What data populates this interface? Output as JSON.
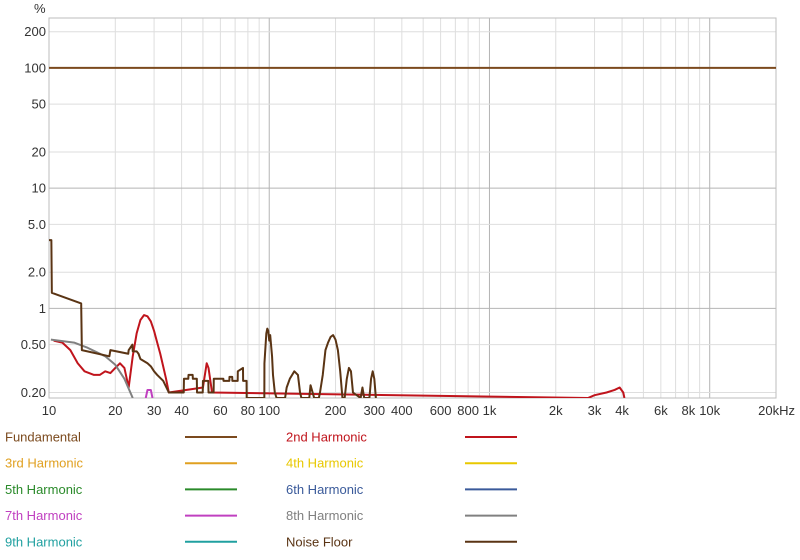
{
  "chart_data": {
    "type": "line",
    "x_scale": "log",
    "y_scale": "log",
    "xlim": [
      10,
      20000
    ],
    "ylim": [
      0.18,
      260
    ],
    "yunit": "%",
    "xunit": "kHz",
    "grid": true,
    "legend_position": "bottom",
    "y_ticks": [
      {
        "value": 200,
        "label": "200"
      },
      {
        "value": 100,
        "label": "100"
      },
      {
        "value": 50,
        "label": "50"
      },
      {
        "value": 20,
        "label": "20"
      },
      {
        "value": 10,
        "label": "10"
      },
      {
        "value": 5,
        "label": "5.0"
      },
      {
        "value": 2,
        "label": "2.0"
      },
      {
        "value": 1,
        "label": "1"
      },
      {
        "value": 0.5,
        "label": "0.50"
      },
      {
        "value": 0.2,
        "label": "0.20"
      }
    ],
    "x_ticks": [
      {
        "value": 10,
        "label": "10"
      },
      {
        "value": 20,
        "label": "20"
      },
      {
        "value": 30,
        "label": "30"
      },
      {
        "value": 40,
        "label": "40"
      },
      {
        "value": 60,
        "label": "60"
      },
      {
        "value": 80,
        "label": "80"
      },
      {
        "value": 100,
        "label": "100"
      },
      {
        "value": 200,
        "label": "200"
      },
      {
        "value": 300,
        "label": "300"
      },
      {
        "value": 400,
        "label": "400"
      },
      {
        "value": 600,
        "label": "600"
      },
      {
        "value": 800,
        "label": "800"
      },
      {
        "value": 1000,
        "label": "1k"
      },
      {
        "value": 2000,
        "label": "2k"
      },
      {
        "value": 3000,
        "label": "3k"
      },
      {
        "value": 4000,
        "label": "4k"
      },
      {
        "value": 6000,
        "label": "6k"
      },
      {
        "value": 8000,
        "label": "8k"
      },
      {
        "value": 10000,
        "label": "10k"
      },
      {
        "value": 20000,
        "label": "20kHz"
      }
    ],
    "series": [
      {
        "name": "Fundamental",
        "color": "#7b4a1e",
        "points": [
          [
            10,
            100
          ],
          [
            20000,
            100
          ]
        ]
      },
      {
        "name": "2nd Harmonic",
        "color": "#c0141c",
        "points": [
          [
            10.5,
            0.54
          ],
          [
            11.5,
            0.52
          ],
          [
            12.5,
            0.45
          ],
          [
            13.5,
            0.35
          ],
          [
            14.5,
            0.3
          ],
          [
            16,
            0.28
          ],
          [
            17,
            0.28
          ],
          [
            18,
            0.3
          ],
          [
            19,
            0.29
          ],
          [
            20,
            0.32
          ],
          [
            21,
            0.35
          ],
          [
            22,
            0.32
          ],
          [
            23,
            0.22
          ],
          [
            24,
            0.4
          ],
          [
            25,
            0.62
          ],
          [
            26,
            0.8
          ],
          [
            27,
            0.88
          ],
          [
            28,
            0.86
          ],
          [
            29,
            0.78
          ],
          [
            30,
            0.65
          ],
          [
            31,
            0.52
          ],
          [
            32,
            0.42
          ],
          [
            33,
            0.33
          ],
          [
            34,
            0.26
          ],
          [
            35,
            0.2
          ],
          [
            50,
            0.22
          ],
          [
            52,
            0.35
          ],
          [
            53,
            0.32
          ],
          [
            55,
            0.2
          ],
          [
            2800,
            0.18
          ],
          [
            3000,
            0.19
          ],
          [
            3400,
            0.2
          ],
          [
            3700,
            0.21
          ],
          [
            3900,
            0.22
          ],
          [
            4050,
            0.2
          ],
          [
            4100,
            0.18
          ]
        ]
      },
      {
        "name": "3rd Harmonic",
        "color": "#e0a020",
        "points": []
      },
      {
        "name": "4th Harmonic",
        "color": "#e8c800",
        "points": []
      },
      {
        "name": "5th Harmonic",
        "color": "#2a8a2a",
        "points": []
      },
      {
        "name": "6th Harmonic",
        "color": "#3a5a9a",
        "points": []
      },
      {
        "name": "7th Harmonic",
        "color": "#c040c0",
        "points": [
          [
            27.5,
            0.18
          ],
          [
            28,
            0.21
          ],
          [
            29,
            0.21
          ],
          [
            29.5,
            0.18
          ]
        ]
      },
      {
        "name": "8th Harmonic",
        "color": "#808080",
        "points": [
          [
            10.2,
            0.55
          ],
          [
            13,
            0.52
          ],
          [
            15,
            0.47
          ],
          [
            18,
            0.4
          ],
          [
            20,
            0.34
          ],
          [
            22,
            0.26
          ],
          [
            24,
            0.18
          ]
        ]
      },
      {
        "name": "9th Harmonic",
        "color": "#20a0a0",
        "points": []
      },
      {
        "name": "Noise Floor",
        "color": "#5a3414",
        "points": [
          [
            10,
            3.7
          ],
          [
            10.25,
            3.7
          ],
          [
            10.3,
            1.35
          ],
          [
            14,
            1.1
          ],
          [
            14.1,
            0.45
          ],
          [
            18.8,
            0.4
          ],
          [
            19,
            0.45
          ],
          [
            22.9,
            0.42
          ],
          [
            23,
            0.45
          ],
          [
            23.9,
            0.5
          ],
          [
            24,
            0.44
          ],
          [
            25,
            0.44
          ],
          [
            25.5,
            0.42
          ],
          [
            26,
            0.38
          ],
          [
            28,
            0.35
          ],
          [
            29,
            0.33
          ],
          [
            30,
            0.3
          ],
          [
            31,
            0.28
          ],
          [
            33,
            0.25
          ],
          [
            35,
            0.2
          ],
          [
            40.9,
            0.2
          ],
          [
            41,
            0.26
          ],
          [
            42.9,
            0.26
          ],
          [
            43,
            0.28
          ],
          [
            44.9,
            0.28
          ],
          [
            45,
            0.26
          ],
          [
            46.9,
            0.26
          ],
          [
            47,
            0.2
          ],
          [
            49.9,
            0.2
          ],
          [
            50,
            0.25
          ],
          [
            52.9,
            0.25
          ],
          [
            53,
            0.2
          ],
          [
            55.9,
            0.2
          ],
          [
            56,
            0.26
          ],
          [
            61.9,
            0.26
          ],
          [
            62,
            0.25
          ],
          [
            65.9,
            0.25
          ],
          [
            66,
            0.27
          ],
          [
            67.9,
            0.27
          ],
          [
            68,
            0.25
          ],
          [
            71.9,
            0.25
          ],
          [
            72,
            0.3
          ],
          [
            76,
            0.32
          ],
          [
            76.1,
            0.25
          ],
          [
            78.9,
            0.25
          ],
          [
            79,
            0.18
          ],
          [
            95,
            0.18
          ],
          [
            95.1,
            0.35
          ],
          [
            97,
            0.62
          ],
          [
            98,
            0.68
          ],
          [
            99,
            0.65
          ],
          [
            100,
            0.54
          ],
          [
            101,
            0.6
          ],
          [
            103,
            0.4
          ],
          [
            104,
            0.28
          ],
          [
            106,
            0.2
          ],
          [
            108,
            0.18
          ],
          [
            118,
            0.18
          ],
          [
            120,
            0.22
          ],
          [
            124,
            0.26
          ],
          [
            130,
            0.3
          ],
          [
            135,
            0.28
          ],
          [
            138,
            0.2
          ],
          [
            140,
            0.18
          ],
          [
            152,
            0.18
          ],
          [
            154,
            0.23
          ],
          [
            160,
            0.18
          ],
          [
            168,
            0.18
          ],
          [
            170,
            0.2
          ],
          [
            175,
            0.28
          ],
          [
            180,
            0.45
          ],
          [
            185,
            0.52
          ],
          [
            190,
            0.58
          ],
          [
            195,
            0.6
          ],
          [
            200,
            0.55
          ],
          [
            205,
            0.45
          ],
          [
            210,
            0.3
          ],
          [
            215,
            0.18
          ],
          [
            220,
            0.18
          ],
          [
            225,
            0.26
          ],
          [
            230,
            0.32
          ],
          [
            235,
            0.3
          ],
          [
            240,
            0.2
          ],
          [
            260,
            0.18
          ],
          [
            265,
            0.22
          ],
          [
            270,
            0.18
          ],
          [
            285,
            0.18
          ],
          [
            290,
            0.26
          ],
          [
            295,
            0.3
          ],
          [
            300,
            0.26
          ],
          [
            305,
            0.18
          ]
        ]
      }
    ]
  }
}
